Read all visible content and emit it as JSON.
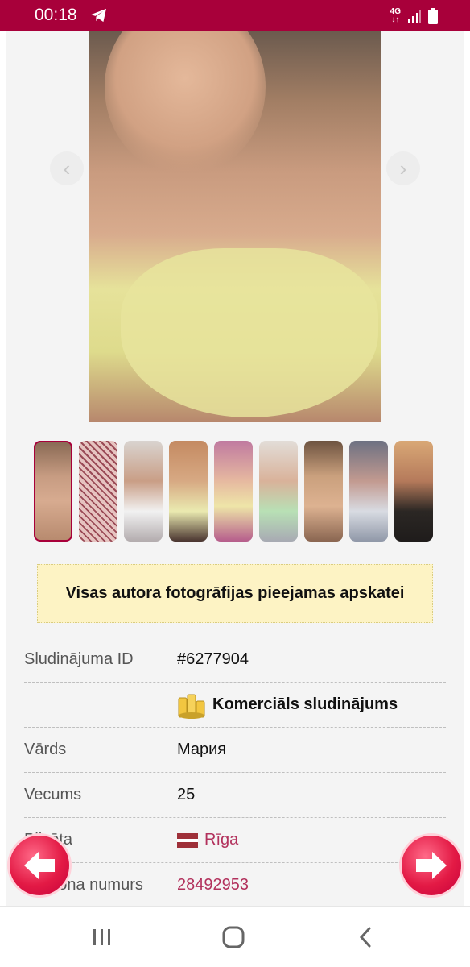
{
  "status_bar": {
    "time": "00:18",
    "network": "4G",
    "icons": [
      "telegram-icon",
      "signal-icon",
      "battery-icon"
    ]
  },
  "gallery": {
    "prev_icon": "chevron-left-icon",
    "next_icon": "chevron-right-icon",
    "thumbnail_count": 9,
    "active_thumbnail": 1
  },
  "notice": {
    "text": "Visas autora fotogrāfijas pieejamas apskatei"
  },
  "details": {
    "rows": [
      {
        "label": "Sludinājuma ID",
        "value": "#6277904"
      },
      {
        "label": "",
        "value": "Komerciāls sludinājums",
        "icon": "coins-icon"
      },
      {
        "label": "Vārds",
        "value": "Мария"
      },
      {
        "label": "Vecums",
        "value": "25"
      },
      {
        "label": "Pilsēta",
        "value": "Rīga",
        "icon": "latvia-flag-icon"
      },
      {
        "label": "Telefona numurs",
        "value": "28492953"
      }
    ]
  },
  "floating_nav": {
    "prev_icon": "arrow-left-icon",
    "next_icon": "arrow-right-icon"
  },
  "system_nav": {
    "icons": [
      "recent-apps-icon",
      "home-icon",
      "back-icon"
    ]
  },
  "colors": {
    "brand": "#a8003a",
    "link": "#b2315c",
    "notice_bg": "#fdf3c4",
    "float_button": "#e31a45"
  }
}
